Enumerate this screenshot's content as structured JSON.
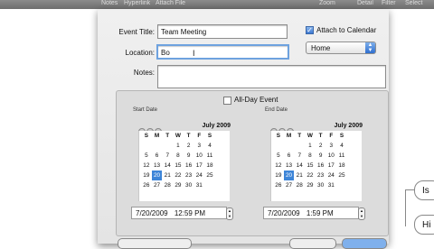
{
  "toolbar": {
    "items": [
      "Notes",
      "Hyperlink",
      "Attach File",
      "Zoom",
      "Detail",
      "Filter",
      "Select"
    ]
  },
  "form": {
    "title_label": "Event Title:",
    "title_value": "Team Meeting",
    "location_label": "Location:",
    "location_value": "Bo",
    "notes_label": "Notes:",
    "attach_label": "Attach to Calendar",
    "calendar_select": "Home",
    "all_day_label": "All-Day Event"
  },
  "start": {
    "caption": "Start Date",
    "month": "July 2009",
    "days_header": [
      "S",
      "M",
      "T",
      "W",
      "T",
      "F",
      "S"
    ],
    "weeks": [
      [
        "",
        "",
        "",
        "1",
        "2",
        "3",
        "4"
      ],
      [
        "5",
        "6",
        "7",
        "8",
        "9",
        "10",
        "11"
      ],
      [
        "12",
        "13",
        "14",
        "15",
        "16",
        "17",
        "18"
      ],
      [
        "19",
        "20",
        "21",
        "22",
        "23",
        "24",
        "25"
      ],
      [
        "26",
        "27",
        "28",
        "29",
        "30",
        "31",
        ""
      ]
    ],
    "selected": "20",
    "date": "7/20/2009",
    "time": "12:59 PM"
  },
  "end": {
    "caption": "End Date",
    "month": "July 2009",
    "days_header": [
      "S",
      "M",
      "T",
      "W",
      "T",
      "F",
      "S"
    ],
    "weeks": [
      [
        "",
        "",
        "",
        "1",
        "2",
        "3",
        "4"
      ],
      [
        "5",
        "6",
        "7",
        "8",
        "9",
        "10",
        "11"
      ],
      [
        "12",
        "13",
        "14",
        "15",
        "16",
        "17",
        "18"
      ],
      [
        "19",
        "20",
        "21",
        "22",
        "23",
        "24",
        "25"
      ],
      [
        "26",
        "27",
        "28",
        "29",
        "30",
        "31",
        ""
      ]
    ],
    "selected": "20",
    "date": "7/20/2009",
    "time": "1:59 PM"
  },
  "background": {
    "node1": "Is",
    "node2": "Hi"
  }
}
